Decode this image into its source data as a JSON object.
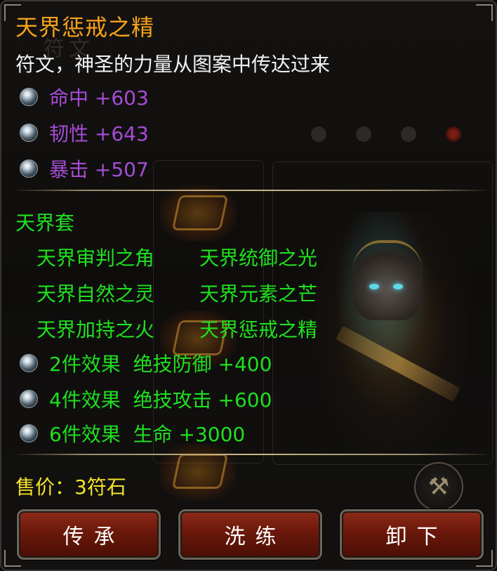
{
  "tooltip": {
    "title": "天界惩戒之精",
    "description": "符文，神圣的力量从图案中传达过来",
    "stats": [
      {
        "label": "命中 +603"
      },
      {
        "label": "韧性 +643"
      },
      {
        "label": "暴击 +507"
      }
    ],
    "set": {
      "name": "天界套",
      "pieces": [
        "天界审判之角",
        "天界统御之光",
        "天界自然之灵",
        "天界元素之芒",
        "天界加持之火",
        "天界惩戒之精"
      ],
      "bonuses": [
        {
          "label": "2件效果  绝技防御 +400"
        },
        {
          "label": "4件效果  绝技攻击 +600"
        },
        {
          "label": "6件效果  生命 +3000"
        }
      ]
    },
    "price": "售价：3符石"
  },
  "buttons": {
    "inherit": "传承",
    "refine": "洗练",
    "unequip": "卸下"
  },
  "background": {
    "ghost_title": "符文"
  },
  "colors": {
    "title": "#f6a21a",
    "stat": "#a54cd6",
    "set": "#1fe01f",
    "price": "#f4e32a",
    "button": "#7a1f10"
  },
  "icons": {
    "stat_bullet": "gem-orb-icon",
    "forge": "hammer-icon"
  }
}
